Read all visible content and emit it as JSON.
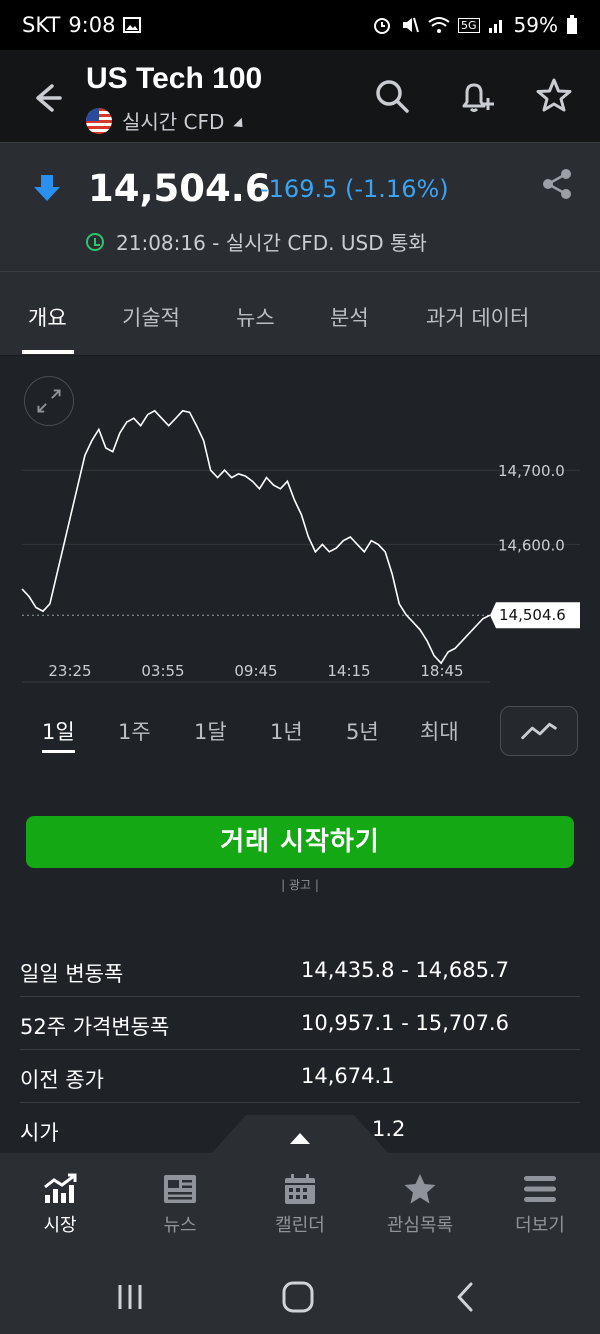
{
  "status": {
    "carrier": "SKT",
    "time": "9:08",
    "battery": "59%",
    "network": "5G"
  },
  "header": {
    "title": "US Tech 100",
    "subtitle": "실시간 CFD",
    "icons": [
      "back-arrow-icon",
      "search-icon",
      "add-alert-icon",
      "star-icon"
    ]
  },
  "quote": {
    "price": "14,504.6",
    "change": "-169.5 (-1.16%)",
    "timestamp": "21:08:16 - 실시간 CFD. USD 통화",
    "change_color": "#3ba3f4"
  },
  "tabs": [
    {
      "label": "개요"
    },
    {
      "label": "기술적"
    },
    {
      "label": "뉴스"
    },
    {
      "label": "분석"
    },
    {
      "label": "과거 데이터"
    }
  ],
  "chart_data": {
    "type": "line",
    "x_ticks": [
      "23:25",
      "03:55",
      "09:45",
      "14:15",
      "18:45"
    ],
    "y_ticks": [
      "14,700.0",
      "14,600.0"
    ],
    "last_value_label": "14,504.6",
    "ylim": [
      14420,
      14800
    ],
    "values": [
      14540,
      14530,
      14515,
      14510,
      14520,
      14560,
      14600,
      14640,
      14680,
      14720,
      14740,
      14755,
      14730,
      14725,
      14750,
      14765,
      14770,
      14760,
      14775,
      14780,
      14770,
      14760,
      14770,
      14780,
      14778,
      14760,
      14740,
      14700,
      14690,
      14700,
      14690,
      14695,
      14692,
      14685,
      14675,
      14690,
      14680,
      14675,
      14685,
      14660,
      14640,
      14610,
      14590,
      14600,
      14590,
      14595,
      14605,
      14610,
      14600,
      14590,
      14605,
      14600,
      14590,
      14560,
      14520,
      14505,
      14495,
      14485,
      14470,
      14450,
      14440,
      14455,
      14460,
      14470,
      14480,
      14490,
      14500,
      14504.6
    ],
    "line_color": "#ffffff",
    "grid": true
  },
  "ranges": [
    {
      "label": "1일"
    },
    {
      "label": "1주"
    },
    {
      "label": "1달"
    },
    {
      "label": "1년"
    },
    {
      "label": "5년"
    },
    {
      "label": "최대"
    }
  ],
  "cta": {
    "label": "거래 시작하기",
    "ad": "| 광고 |",
    "color": "#14a814"
  },
  "stats": [
    {
      "label": "일일 변동폭",
      "value": "14,435.8 - 14,685.7"
    },
    {
      "label": "52주 가격변동폭",
      "value": "10,957.1 - 15,707.6"
    },
    {
      "label": "이전 종가",
      "value": "14,674.1"
    },
    {
      "label": "시가",
      "value": "1.2"
    }
  ],
  "bottom_nav": [
    {
      "label": "시장",
      "icon": "chart-trend-icon"
    },
    {
      "label": "뉴스",
      "icon": "newspaper-icon"
    },
    {
      "label": "캘린더",
      "icon": "calendar-icon"
    },
    {
      "label": "관심목록",
      "icon": "star-icon"
    },
    {
      "label": "더보기",
      "icon": "menu-icon"
    }
  ]
}
